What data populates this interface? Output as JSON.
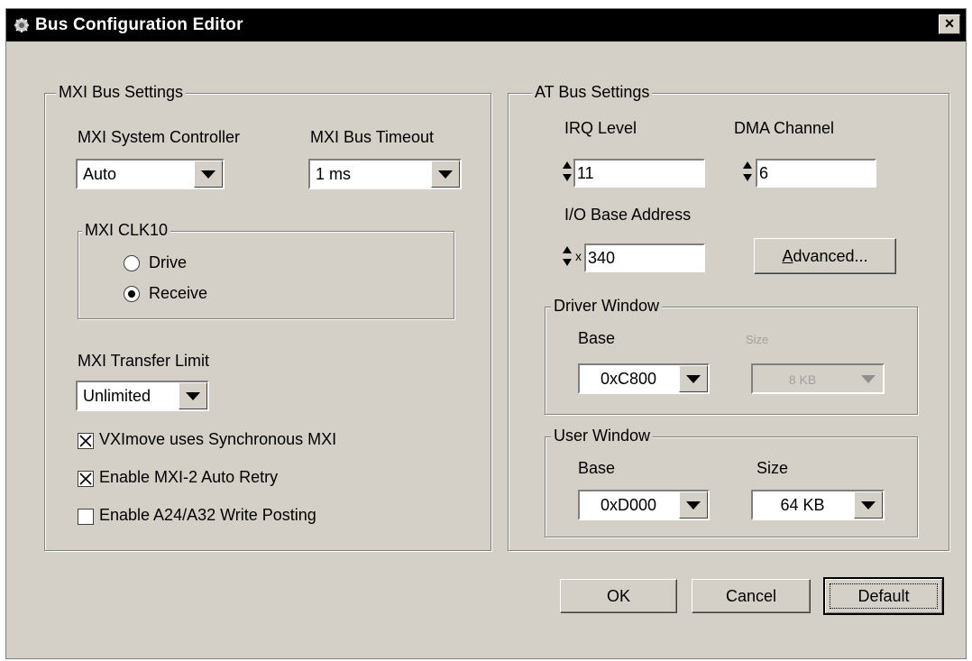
{
  "window": {
    "title": "Bus Configuration Editor",
    "close_glyph": "×"
  },
  "mxi": {
    "legend": "MXI Bus Settings",
    "system_controller": {
      "label": "MXI System Controller",
      "value": "Auto"
    },
    "bus_timeout": {
      "label": "MXI Bus Timeout",
      "value": "1 ms"
    },
    "clk10": {
      "legend": "MXI CLK10",
      "options": [
        {
          "label": "Drive",
          "selected": false
        },
        {
          "label": "Receive",
          "selected": true
        }
      ]
    },
    "transfer_limit": {
      "label": "MXI Transfer Limit",
      "value": "Unlimited"
    },
    "checkboxes": [
      {
        "label": "VXImove uses Synchronous MXI",
        "checked": true
      },
      {
        "label": "Enable MXI-2 Auto Retry",
        "checked": true
      },
      {
        "label": "Enable A24/A32 Write Posting",
        "checked": false
      }
    ]
  },
  "at": {
    "legend": "AT Bus Settings",
    "irq": {
      "label": "IRQ Level",
      "value": "11"
    },
    "dma": {
      "label": "DMA Channel",
      "value": "6"
    },
    "io_base": {
      "label": "I/O Base Address",
      "prefix": "x",
      "value": "340"
    },
    "advanced_button": {
      "label_first": "A",
      "label_rest": "dvanced..."
    },
    "driver_window": {
      "legend": "Driver Window",
      "base_label": "Base",
      "base_value": "0xC800",
      "size_label": "Size",
      "size_value": "8 KB",
      "size_disabled": true
    },
    "user_window": {
      "legend": "User Window",
      "base_label": "Base",
      "base_value": "0xD000",
      "size_label": "Size",
      "size_value": "64 KB"
    }
  },
  "buttons": {
    "ok": "OK",
    "cancel": "Cancel",
    "default": "Default"
  },
  "colors": {
    "dialog_face": "#d4d0c8",
    "title_bar": "#000000",
    "field": "#ffffff"
  }
}
